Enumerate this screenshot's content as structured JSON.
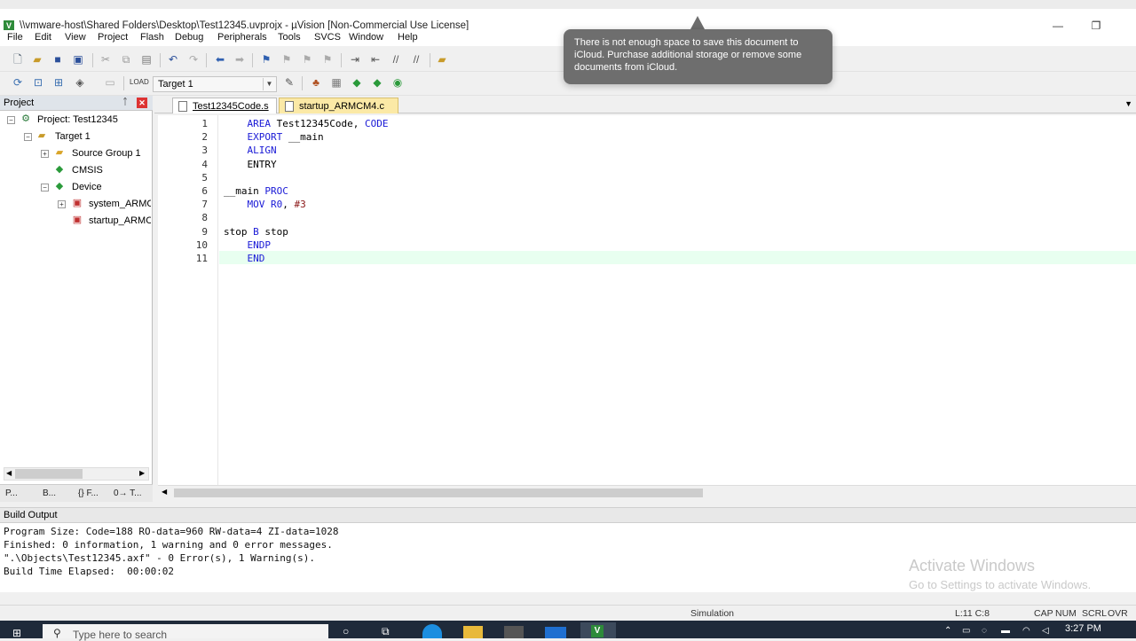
{
  "window": {
    "title": "\\\\vmware-host\\Shared Folders\\Desktop\\Test12345.uvprojx - µVision  [Non-Commercial Use License]",
    "app_icon": "V",
    "controls": {
      "minimize": "—",
      "restore": "❐",
      "close": "✕"
    }
  },
  "menubar": {
    "items": [
      "File",
      "Edit",
      "View",
      "Project",
      "Flash",
      "Debug",
      "Peripherals",
      "Tools",
      "SVCS",
      "Window",
      "Help"
    ]
  },
  "toolbar2": {
    "target_select": "Target 1"
  },
  "project_panel": {
    "title": "Project",
    "pin_icon": "pin-icon",
    "close_icon": "close-icon",
    "tree": [
      {
        "label": "Project: Test12345",
        "icon": "project-icon"
      },
      {
        "label": "Target 1",
        "icon": "folder-icon"
      },
      {
        "label": "Source Group 1",
        "icon": "folder-icon"
      },
      {
        "label": "CMSIS",
        "icon": "gem-icon"
      },
      {
        "label": "Device",
        "icon": "gem-icon"
      },
      {
        "label": "system_ARMC",
        "icon": "c-file-icon"
      },
      {
        "label": "startup_ARMC",
        "icon": "c-file-icon"
      }
    ],
    "tabs": [
      "P...",
      "B...",
      "{} F...",
      "0→ T..."
    ]
  },
  "editor": {
    "tabs": [
      {
        "label": "Test12345Code.s",
        "active": true
      },
      {
        "label": "startup_ARMCM4.c",
        "active": false
      }
    ],
    "lines": [
      {
        "n": "1",
        "indent": "    ",
        "parts": [
          [
            "kw",
            "AREA"
          ],
          [
            "t",
            " Test12345Code, "
          ],
          [
            "kw",
            "CODE"
          ]
        ]
      },
      {
        "n": "2",
        "indent": "    ",
        "parts": [
          [
            "kw",
            "EXPORT"
          ],
          [
            "t",
            " __main"
          ]
        ]
      },
      {
        "n": "3",
        "indent": "    ",
        "parts": [
          [
            "kw",
            "ALIGN"
          ]
        ]
      },
      {
        "n": "4",
        "indent": "    ",
        "parts": [
          [
            "t",
            "ENTRY"
          ]
        ]
      },
      {
        "n": "5",
        "indent": "",
        "parts": []
      },
      {
        "n": "6",
        "indent": "",
        "parts": [
          [
            "t",
            "__main "
          ],
          [
            "kw",
            "PROC"
          ]
        ]
      },
      {
        "n": "7",
        "indent": "    ",
        "parts": [
          [
            "kw",
            "MOV"
          ],
          [
            "t",
            " "
          ],
          [
            "kw",
            "R0"
          ],
          [
            "t",
            ", "
          ],
          [
            "num",
            "#3"
          ]
        ]
      },
      {
        "n": "8",
        "indent": "",
        "parts": []
      },
      {
        "n": "9",
        "indent": "",
        "parts": [
          [
            "t",
            "stop "
          ],
          [
            "kw",
            "B"
          ],
          [
            "t",
            " stop"
          ]
        ]
      },
      {
        "n": "10",
        "indent": "    ",
        "parts": [
          [
            "kw",
            "ENDP"
          ]
        ]
      },
      {
        "n": "11",
        "indent": "    ",
        "parts": [
          [
            "kw",
            "END"
          ]
        ]
      }
    ]
  },
  "build_output": {
    "title": "Build Output",
    "lines": [
      "Program Size: Code=188 RO-data=960 RW-data=4 ZI-data=1028",
      "Finished: 0 information, 1 warning and 0 error messages.",
      "\".\\Objects\\Test12345.axf\" - 0 Error(s), 1 Warning(s).",
      "Build Time Elapsed:  00:00:02"
    ]
  },
  "statusbar": {
    "mode": "Simulation",
    "position": "L:11 C:8",
    "indicators": [
      "CAP",
      "NUM",
      "SCRL",
      "OVR"
    ]
  },
  "notification": {
    "text": "There is not enough space to save this document to iCloud. Purchase additional storage or remove some documents from iCloud."
  },
  "watermark": {
    "line1": "Activate Windows",
    "line2": "Go to Settings to activate Windows."
  },
  "taskbar": {
    "search_placeholder": "Type here to search",
    "time": "3:27 PM"
  },
  "colors": {
    "keyword": "#1a1ad6",
    "number": "#8a1515",
    "current_line": "#e8fff0",
    "notification_bg": "#6e6e6e"
  }
}
